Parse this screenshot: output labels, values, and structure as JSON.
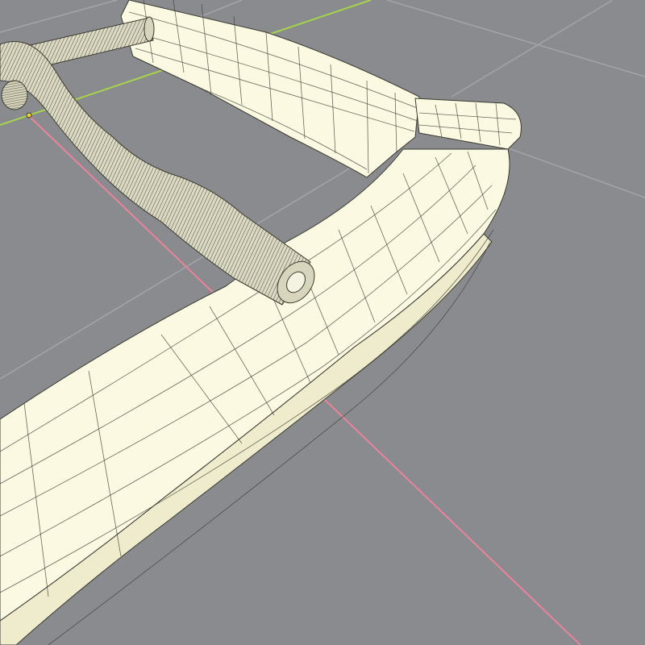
{
  "viewport": {
    "background": "#8a8b8e",
    "grid_color": "#a4a5a8",
    "x_axis_color": "#e8849c",
    "y_axis_color": "#a6d44a"
  },
  "model": {
    "face_color": "#fbf9e2",
    "shade_color": "#efeccd",
    "wire_color": "#3a3a30",
    "rod_color": "#d8d5bd"
  }
}
